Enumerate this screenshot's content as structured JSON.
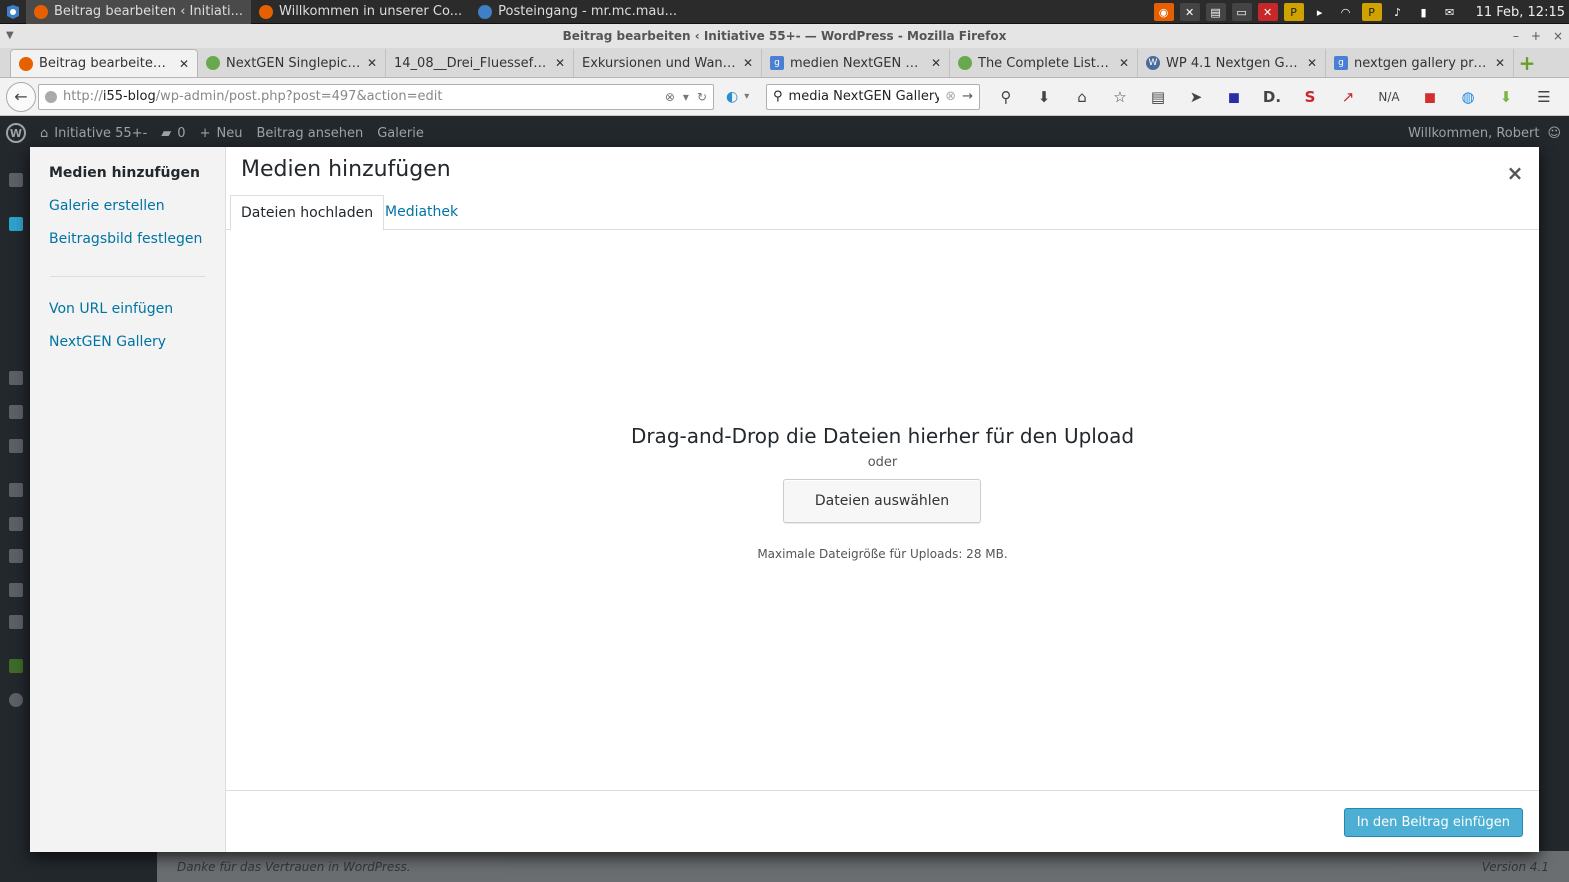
{
  "taskbar": {
    "tasks": [
      {
        "label": "Beitrag bearbeiten ‹ Initiati..."
      },
      {
        "label": "Willkommen in unserer Co..."
      },
      {
        "label": "Posteingang - mr.mc.mau..."
      }
    ],
    "clock": "11 Feb, 12:15"
  },
  "window": {
    "title": "Beitrag bearbeiten ‹ Initiative 55+- — WordPress - Mozilla Firefox"
  },
  "tabs": [
    {
      "label": "Beitrag bearbeiten ‹ Initi...",
      "favicon": "firefox-icon",
      "color": "#e66000"
    },
    {
      "label": "NextGEN Singlepics ...",
      "favicon": "nextgen-icon",
      "color": "#6aa84f"
    },
    {
      "label": "14_08__Drei_Fluessefahr...",
      "favicon": "",
      "color": ""
    },
    {
      "label": "Exkursionen und Wand...",
      "favicon": "",
      "color": ""
    },
    {
      "label": "medien NextGEN Ga...",
      "favicon": "google-icon",
      "color": "#4a7fd4"
    },
    {
      "label": "The Complete List of...",
      "favicon": "nextgen-icon",
      "color": "#6aa84f"
    },
    {
      "label": "WP 4.1 Nextgen Gall...",
      "favicon": "wordpress-icon",
      "color": "#4b6b9a"
    },
    {
      "label": "nextgen gallery pro...",
      "favicon": "google-icon",
      "color": "#4a7fd4"
    }
  ],
  "navbar": {
    "url_prefix": "http://",
    "url_host": "i55-blog",
    "url_path": "/wp-admin/post.php?post=497&action=edit",
    "search_value": "media NextGEN Gallery",
    "na_label": "N/A"
  },
  "wpbar": {
    "site": "Initiative 55+-",
    "comments": "0",
    "new": "Neu",
    "view_post": "Beitrag ansehen",
    "gallery": "Galerie",
    "greeting": "Willkommen, Robert"
  },
  "footer": {
    "thanks": "Danke für das Vertrauen in WordPress.",
    "version": "Version 4.1"
  },
  "modal": {
    "menu": {
      "active": "Medien hinzufügen",
      "create_gallery": "Galerie erstellen",
      "featured_image": "Beitragsbild festlegen",
      "from_url": "Von URL einfügen",
      "nextgen": "NextGEN Gallery"
    },
    "title": "Medien hinzufügen",
    "close_glyph": "×",
    "tabs": {
      "upload": "Dateien hochladen",
      "library": "Mediathek"
    },
    "upload": {
      "instructions": "Drag-and-Drop die Dateien hierher für den Upload",
      "or": "oder",
      "select_button": "Dateien auswählen",
      "max_size": "Maximale Dateigröße für Uploads: 28 MB."
    },
    "insert_button": "In den Beitrag einfügen"
  },
  "colors": {
    "wp_link": "#0074a2",
    "wp_primary_button": "#2ea2cc",
    "admin_bar": "#23282d"
  }
}
